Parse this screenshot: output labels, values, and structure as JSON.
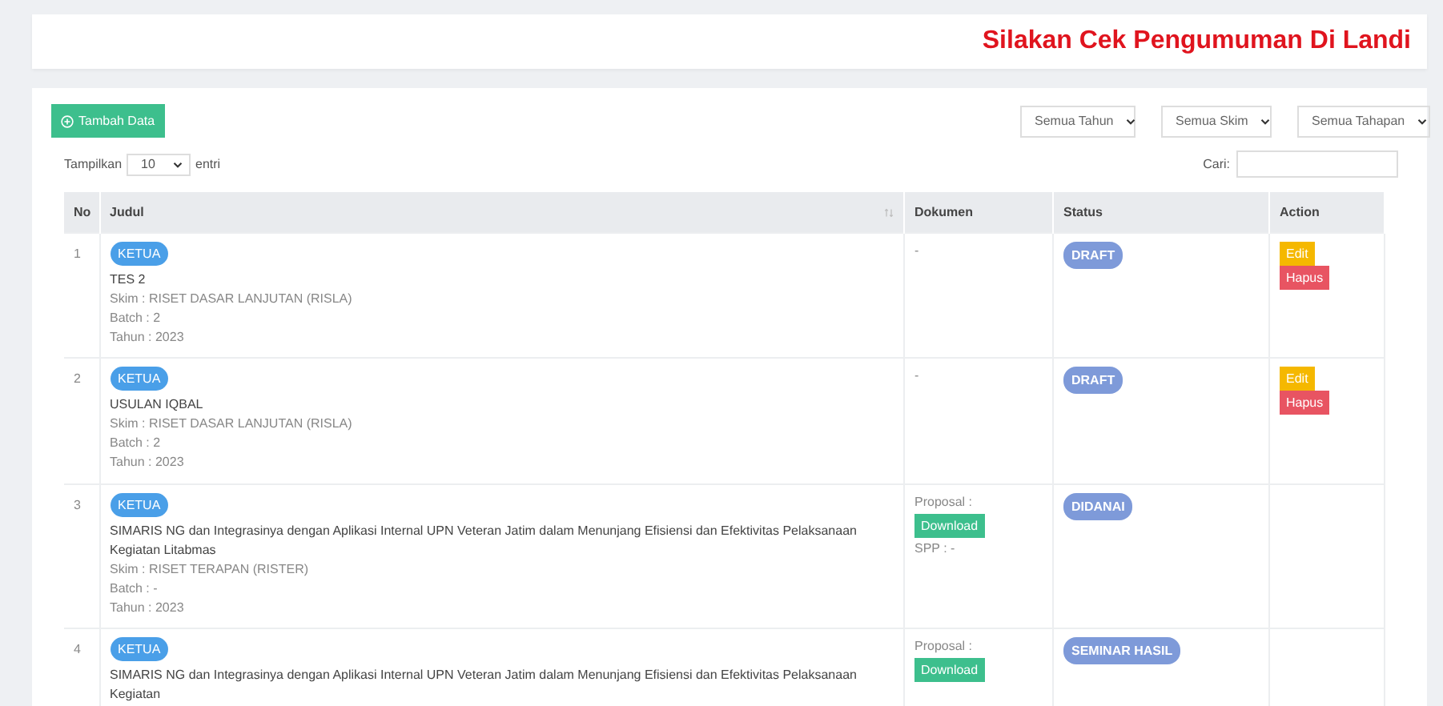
{
  "announcement": "Silakan Cek Pengumuman Di Landi",
  "add_button": "Tambah Data",
  "filters": [
    {
      "label": "Semua Tahun"
    },
    {
      "label": "Semua Skim"
    },
    {
      "label": "Semua Tahapan"
    }
  ],
  "page_length": {
    "prefix": "Tampilkan",
    "value": "10",
    "suffix": "entri"
  },
  "search": {
    "label": "Cari:"
  },
  "table": {
    "columns": [
      "No",
      "Judul",
      "Dokumen",
      "Status",
      "Action"
    ],
    "rows": [
      {
        "no": "1",
        "role": "KETUA",
        "title": "TES 2",
        "skim": "Skim : RISET DASAR LANJUTAN (RISLA)",
        "batch": "Batch : 2",
        "tahun": "Tahun : 2023",
        "document": {
          "kind": "none",
          "text": "-"
        },
        "status": "DRAFT",
        "actions": [
          {
            "kind": "edit",
            "label": "Edit"
          },
          {
            "kind": "delete",
            "label": "Hapus"
          }
        ]
      },
      {
        "no": "2",
        "role": "KETUA",
        "title": "USULAN IQBAL",
        "skim": "Skim : RISET DASAR LANJUTAN (RISLA)",
        "batch": "Batch : 2",
        "tahun": "Tahun : 2023",
        "document": {
          "kind": "none",
          "text": "-"
        },
        "status": "DRAFT",
        "actions": [
          {
            "kind": "edit",
            "label": "Edit"
          },
          {
            "kind": "delete",
            "label": "Hapus"
          }
        ]
      },
      {
        "no": "3",
        "role": "KETUA",
        "title": "SIMARIS NG dan Integrasinya dengan Aplikasi Internal UPN Veteran Jatim dalam Menunjang Efisiensi dan Efektivitas Pelaksanaan Kegiatan Litabmas",
        "skim": "Skim : RISET TERAPAN (RISTER)",
        "batch": "Batch : -",
        "tahun": "Tahun : 2023",
        "document": {
          "kind": "file",
          "label": "Proposal :",
          "button": "Download",
          "spp": "SPP : -"
        },
        "status": "DIDANAI",
        "actions": []
      },
      {
        "no": "4",
        "role": "KETUA",
        "title": "SIMARIS NG dan Integrasinya dengan Aplikasi Internal UPN Veteran Jatim dalam Menunjang Efisiensi dan Efektivitas Pelaksanaan Kegiatan",
        "document": {
          "kind": "file",
          "label": "Proposal :",
          "button": "Download"
        },
        "status": "SEMINAR HASIL",
        "actions": []
      }
    ]
  }
}
